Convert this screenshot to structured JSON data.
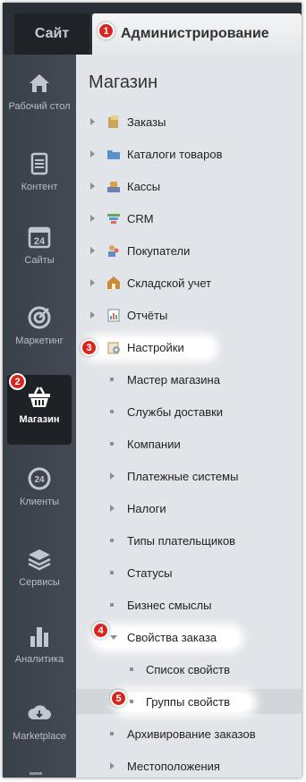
{
  "topbar": {
    "site_tab": "Сайт",
    "admin_tab": "Администрирование"
  },
  "rail": [
    {
      "label": "Рабочий стол",
      "icon": "home-icon"
    },
    {
      "label": "Контент",
      "icon": "document-icon"
    },
    {
      "label": "Сайты",
      "icon": "calendar-24-icon"
    },
    {
      "label": "Маркетинг",
      "icon": "target-icon"
    },
    {
      "label": "Магазин",
      "icon": "basket-icon"
    },
    {
      "label": "Клиенты",
      "icon": "clients-24-icon"
    },
    {
      "label": "Сервисы",
      "icon": "layers-icon"
    },
    {
      "label": "Аналитика",
      "icon": "bar-chart-icon"
    },
    {
      "label": "Marketplace",
      "icon": "cloud-download-icon"
    }
  ],
  "panel": {
    "title": "Магазин",
    "items": [
      "Заказы",
      "Каталоги товаров",
      "Кассы",
      "CRM",
      "Покупатели",
      "Складской учет",
      "Отчёты",
      "Настройки"
    ],
    "settings_children": [
      "Мастер магазина",
      "Службы доставки",
      "Компании",
      "Платежные системы",
      "Налоги",
      "Типы плательщиков",
      "Статусы",
      "Бизнес смыслы",
      "Свойства заказа"
    ],
    "order_props_children": [
      "Список свойств",
      "Группы свойств"
    ],
    "after_items": [
      "Архивирование заказов",
      "Местоположения"
    ]
  },
  "badges": [
    "1",
    "2",
    "3",
    "4",
    "5"
  ],
  "colors": {
    "badge": "#d9261c",
    "rail_bg": "#3c424c",
    "panel_bg": "#e1e4e8"
  }
}
